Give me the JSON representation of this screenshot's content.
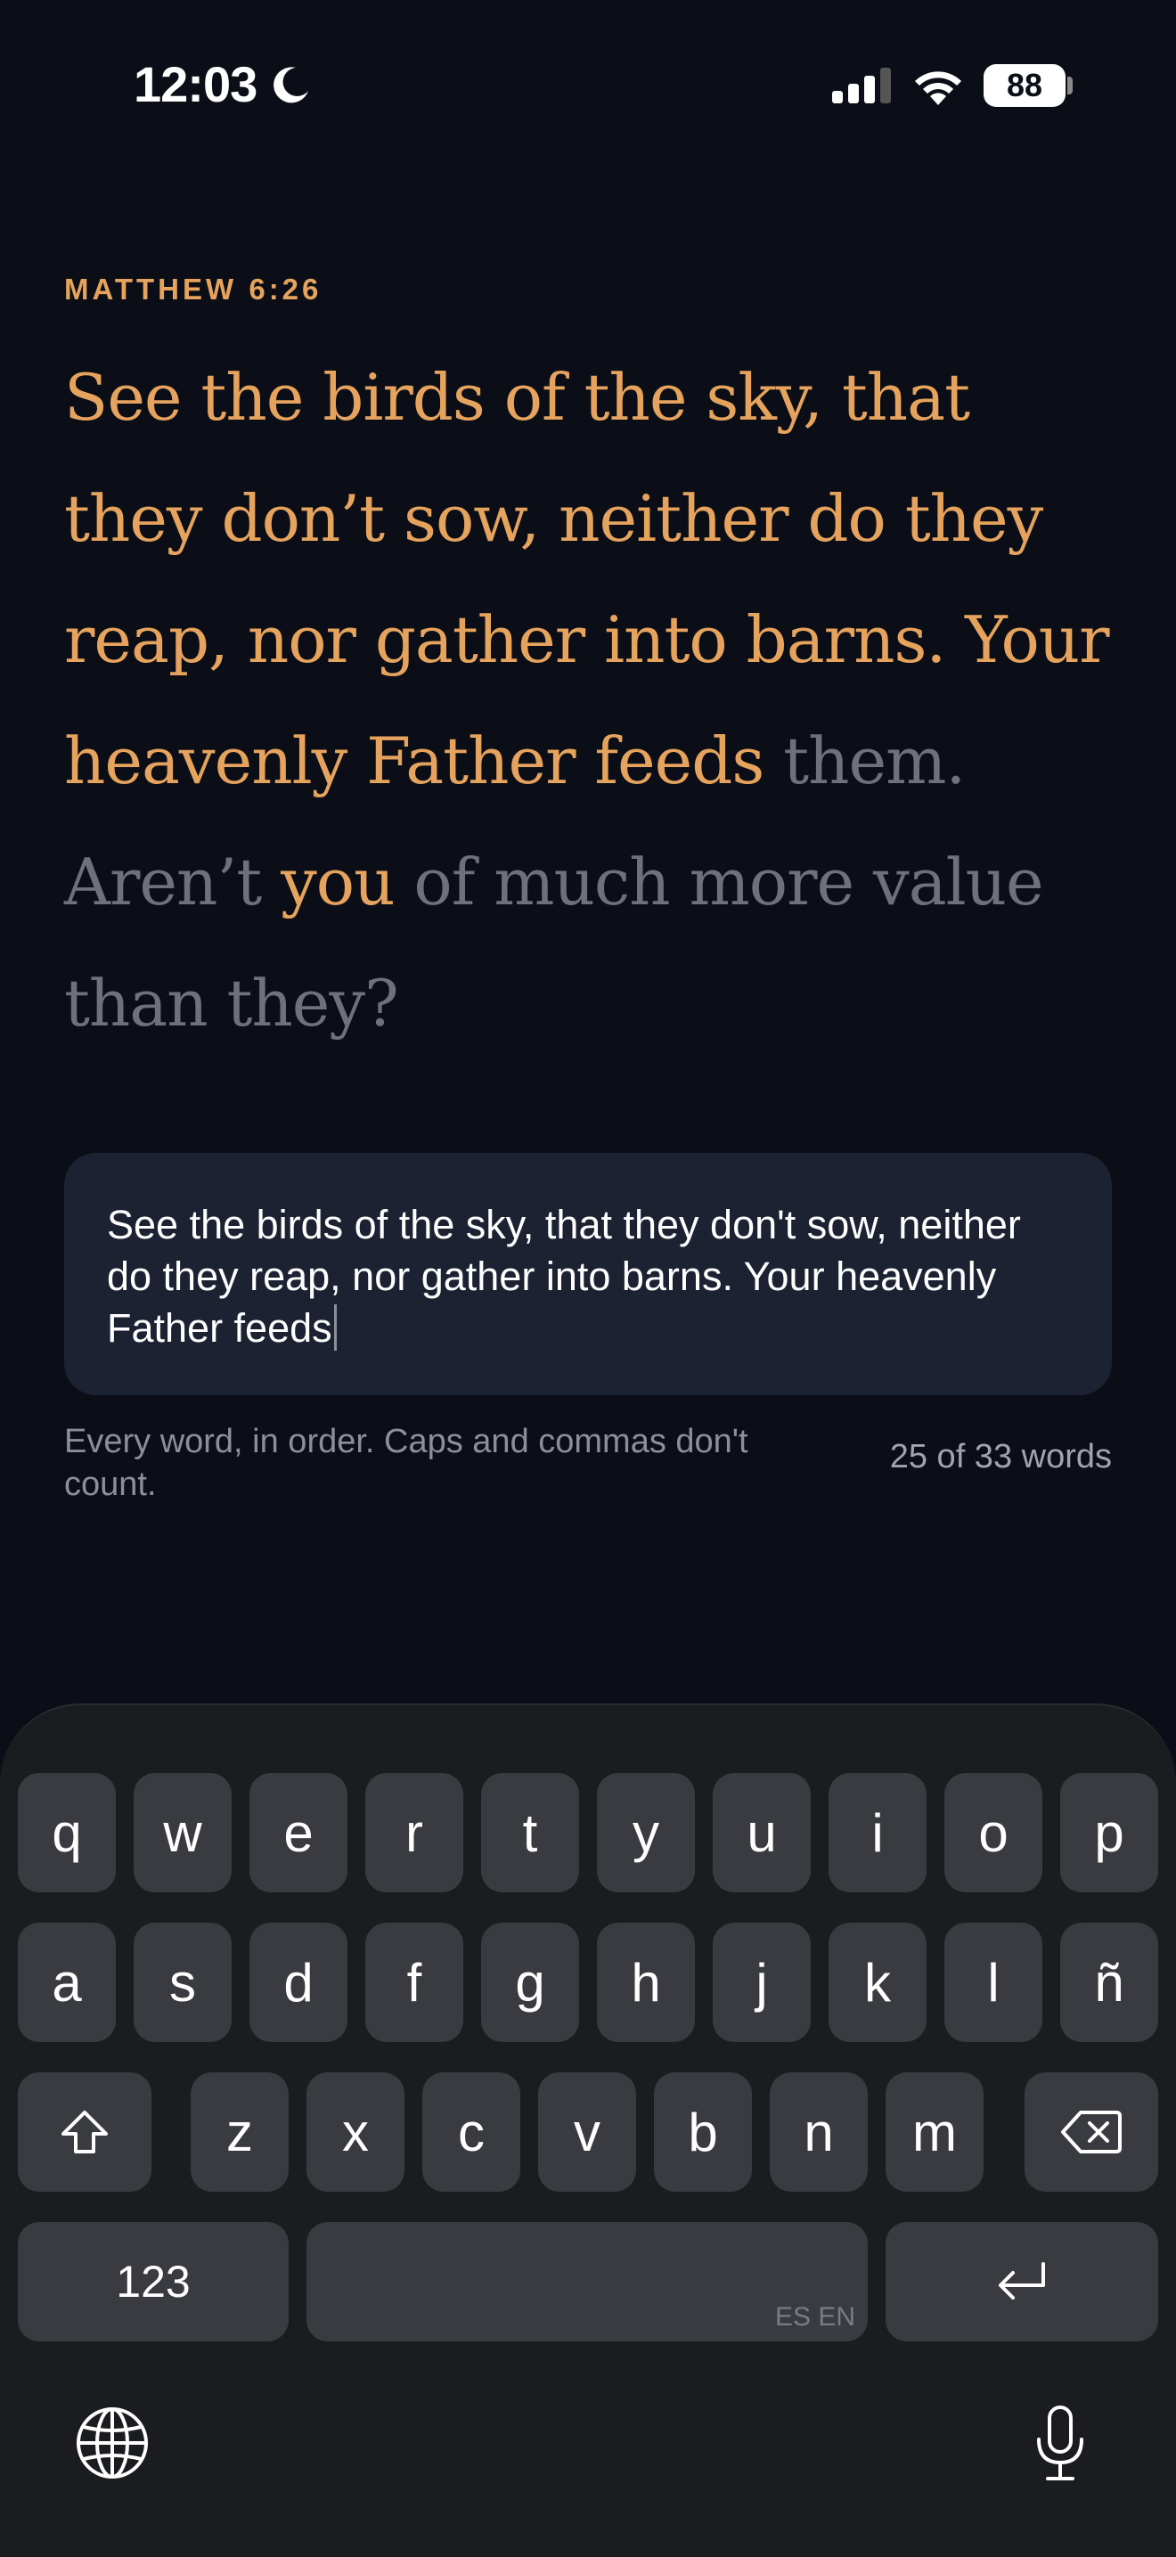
{
  "status_bar": {
    "time": "12:03",
    "battery": "88",
    "icons": [
      "moon-icon",
      "signal-icon",
      "wifi-icon",
      "battery-icon"
    ]
  },
  "verse": {
    "reference": "MATTHEW 6:26",
    "typed_part": "See the birds of the sky, that they don’t sow, neither do they reap, nor gather into barns. Your heavenly Father feeds",
    "remaining_1": " them. Aren’t ",
    "next_word": "you",
    "remaining_2": " of much more value than they?"
  },
  "input": {
    "value": "See the birds of the sky, that they don't sow, neither do they reap, nor gather into barns. Your heavenly Father feeds"
  },
  "hint": "Every word, in order. Caps and commas don't count.",
  "progress": {
    "label": "25 of 33 words",
    "typed": 25,
    "total": 33
  },
  "keyboard": {
    "row1": [
      "q",
      "w",
      "e",
      "r",
      "t",
      "y",
      "u",
      "i",
      "o",
      "p"
    ],
    "row2": [
      "a",
      "s",
      "d",
      "f",
      "g",
      "h",
      "j",
      "k",
      "l",
      "ñ"
    ],
    "row3": [
      "z",
      "x",
      "c",
      "v",
      "b",
      "n",
      "m"
    ],
    "numbers_key": "123",
    "space_hint": "ES EN",
    "icons": [
      "shift-icon",
      "backspace-icon",
      "return-icon",
      "globe-icon",
      "microphone-icon"
    ]
  },
  "colors": {
    "background": "#0b0e17",
    "accent": "#e5a35d",
    "muted_text": "#6f7079",
    "input_bg": "#1c2232",
    "key_bg": "#3a3b40"
  }
}
